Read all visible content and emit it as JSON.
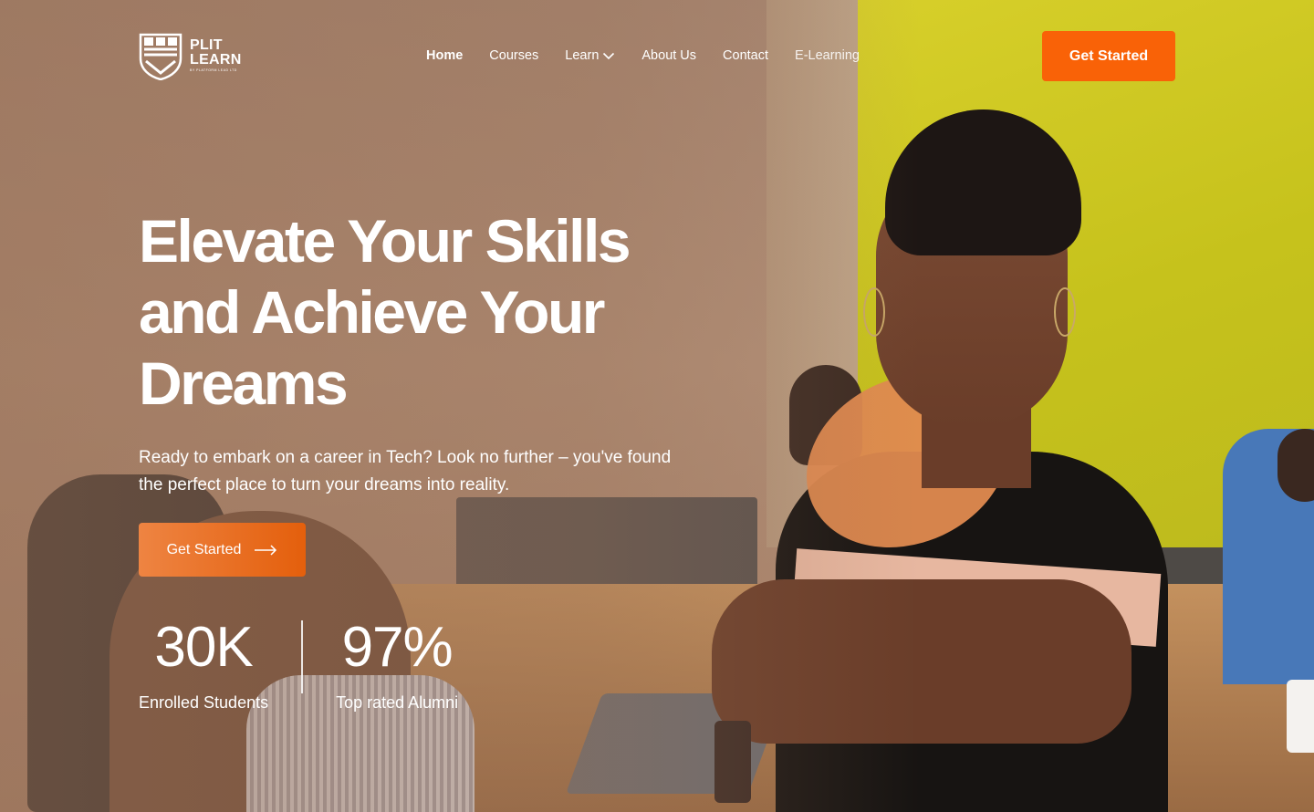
{
  "logo": {
    "line1": "PLIT",
    "line2": "LEARN",
    "tagline": "BY PLATFORM LEAD LTD"
  },
  "nav": {
    "items": [
      {
        "label": "Home",
        "active": true
      },
      {
        "label": "Courses"
      },
      {
        "label": "Learn",
        "has_dropdown": true
      },
      {
        "label": "About Us"
      },
      {
        "label": "Contact"
      },
      {
        "label": "E-Learning"
      }
    ],
    "cta_label": "Get Started"
  },
  "hero": {
    "title_line1": "Elevate Your Skills",
    "title_line2": "and Achieve Your",
    "title_line3": "Dreams",
    "subtitle": "Ready to embark on a career in Tech? Look no further – you've found the perfect place to turn your dreams into reality.",
    "cta_label": "Get Started"
  },
  "stats": [
    {
      "value": "30K",
      "label": "Enrolled Students"
    },
    {
      "value": "97%",
      "label": "Top rated Alumni"
    }
  ],
  "colors": {
    "accent": "#f96207",
    "accent_gradient_start": "#ee8442",
    "accent_gradient_end": "#e45f0c"
  },
  "icons": {
    "logo": "shield-logo-icon",
    "dropdown": "chevron-down-icon",
    "cta_arrow": "arrow-right-icon"
  }
}
